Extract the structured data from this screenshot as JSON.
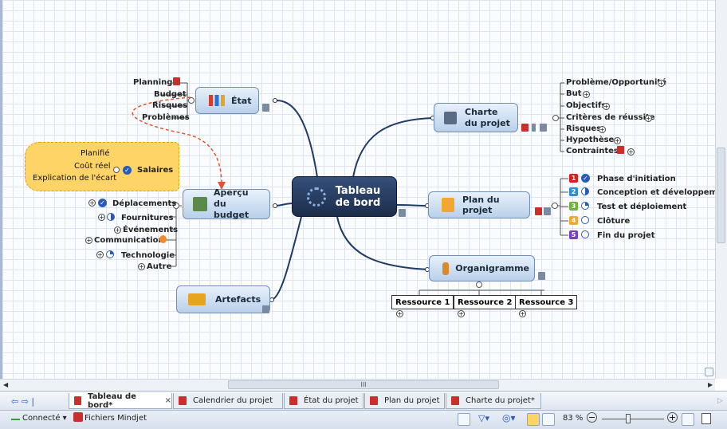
{
  "map": {
    "central": "Tableau de bord",
    "etat": {
      "title": "État",
      "children": [
        "Planning",
        "Budget",
        "Risques",
        "Problèmes"
      ]
    },
    "apercu": {
      "title": "Aperçu du budget",
      "salaires": "Salaires",
      "salaires_children": [
        "Planifié",
        "Coût réel",
        "Explication de l'écart"
      ],
      "children": [
        "Déplacements",
        "Fournitures",
        "Événements",
        "Communication",
        "Technologie",
        "Autre"
      ]
    },
    "artefacts": {
      "title": "Artefacts"
    },
    "charte": {
      "title": "Charte du projet",
      "children": [
        "Problème/Opportunité",
        "But",
        "Objectifs",
        "Critères de réussite",
        "Risques",
        "Hypothèses",
        "Contraintes"
      ]
    },
    "plan": {
      "title": "Plan du projet",
      "phases": [
        {
          "num": "1",
          "label": "Phase d'initiation",
          "color": "#d62020"
        },
        {
          "num": "2",
          "label": "Conception et développement",
          "color": "#2a8fd6"
        },
        {
          "num": "3",
          "label": "Test et déploiement",
          "color": "#6fb43a"
        },
        {
          "num": "4",
          "label": "Clôture",
          "color": "#f0a830"
        },
        {
          "num": "5",
          "label": "Fin du projet",
          "color": "#7b3fc4"
        }
      ]
    },
    "organigramme": {
      "title": "Organigramme",
      "children": [
        "Ressource 1",
        "Ressource 2",
        "Ressource 3"
      ]
    }
  },
  "tabs": [
    "Tableau de bord*",
    "Calendrier du projet",
    "État du projet",
    "Plan du projet",
    "Charte du projet*"
  ],
  "status": {
    "connection": "Connecté",
    "files": "Fichiers Mindjet",
    "zoom": "83 %"
  },
  "scroll": {
    "h_marker": "III"
  },
  "colors": {
    "central": "#24385c",
    "topic": "#b9d0ea",
    "callout": "#ffd466",
    "link": "#e0542a"
  }
}
